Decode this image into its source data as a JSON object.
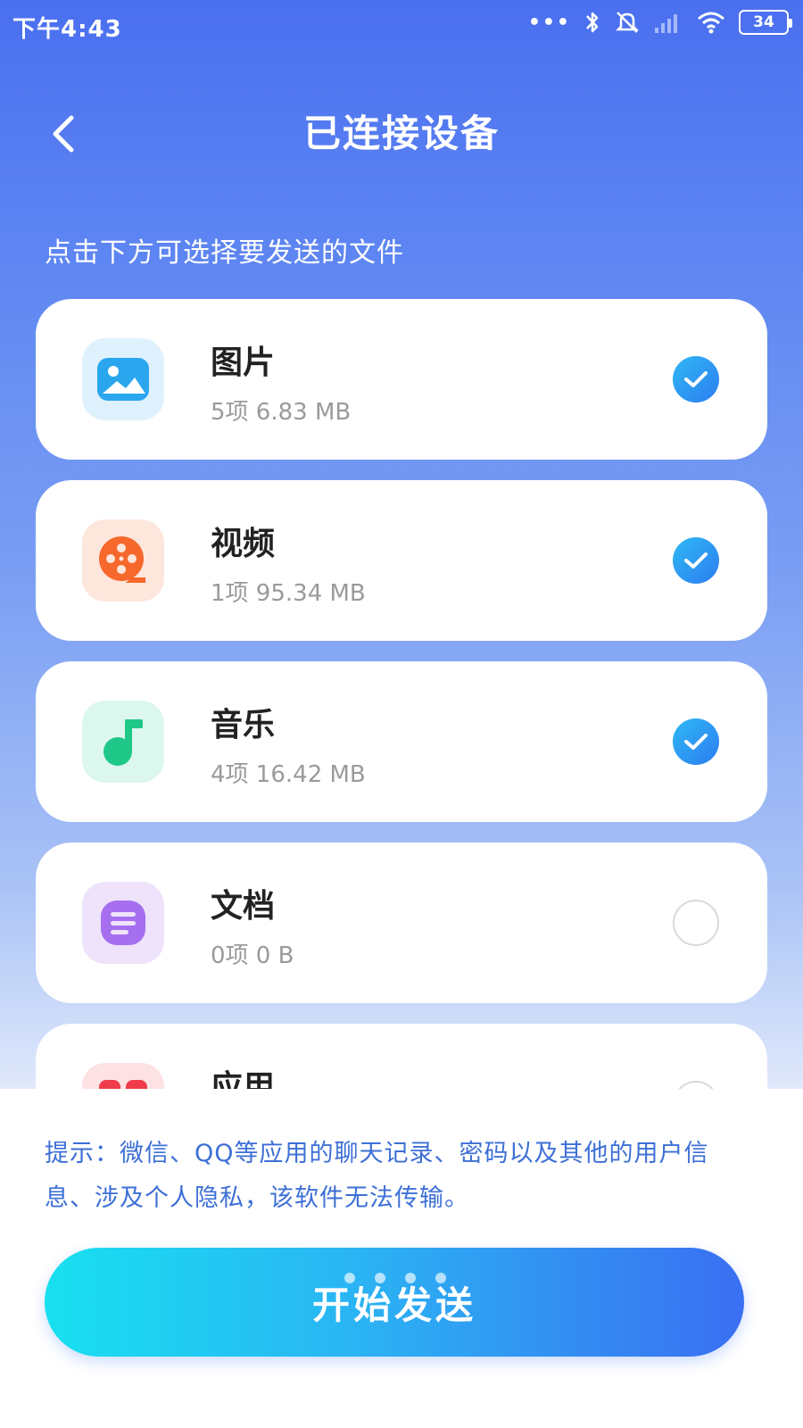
{
  "status_bar": {
    "time": "下午4:43",
    "dots": "•••",
    "battery": "34"
  },
  "header": {
    "title": "已连接设备"
  },
  "subtitle": "点击下方可选择要发送的文件",
  "categories": [
    {
      "name": "图片",
      "meta": "5项 6.83 MB",
      "checked": true,
      "icon": "image-icon",
      "tile_color": "#dff1fc",
      "icon_color": "#2aa6ef"
    },
    {
      "name": "视频",
      "meta": "1项 95.34 MB",
      "checked": true,
      "icon": "film-reel-icon",
      "tile_color": "#fde6dc",
      "icon_color": "#f6682c"
    },
    {
      "name": "音乐",
      "meta": "4项 16.42 MB",
      "checked": true,
      "icon": "music-note-icon",
      "tile_color": "#dcf7ee",
      "icon_color": "#1fc889"
    },
    {
      "name": "文档",
      "meta": "0项 0 B",
      "checked": false,
      "icon": "document-icon",
      "tile_color": "#eee3fb",
      "icon_color": "#a66ff0"
    },
    {
      "name": "应用",
      "meta": "",
      "checked": false,
      "icon": "app-icon",
      "tile_color": "#fde2e4",
      "icon_color": "#ef3b4a"
    }
  ],
  "tip": "提示：微信、QQ等应用的聊天记录、密码以及其他的用户信息、涉及个人隐私，该软件无法传输。",
  "send_button": "开始发送",
  "colors": {
    "accent": "#2c7df0",
    "tip_text": "#3d6fd6"
  }
}
